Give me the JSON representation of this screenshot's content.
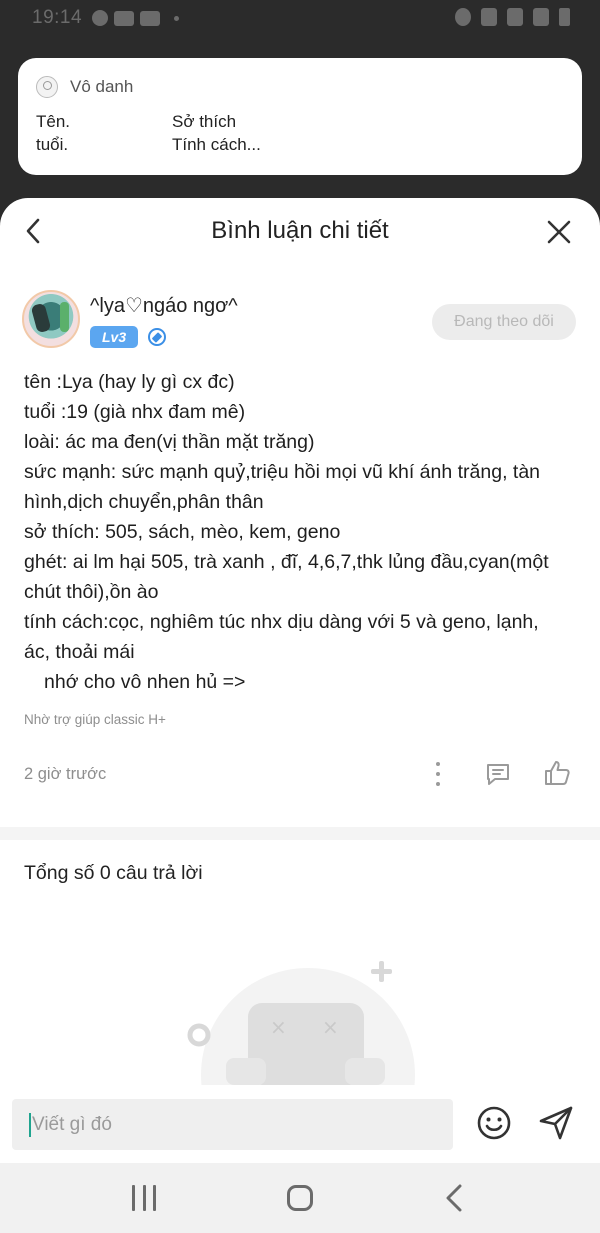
{
  "status_bar": {
    "time": "19:14"
  },
  "notification": {
    "sender": "Vô danh",
    "rows": [
      [
        "Tên.",
        "Sở thích"
      ],
      [
        "tuổi.",
        "Tính cách..."
      ]
    ]
  },
  "sheet": {
    "title": "Bình luận chi tiết"
  },
  "post": {
    "author": "^lya♡ngáo ngơ^",
    "level": "Lv3",
    "follow_label": "Đang theo dõi",
    "lines": [
      "tên :Lya (hay ly gì cx đc)",
      "tuổi :19 (già nhx đam mê)",
      "loài: ác ma đen(vị thần mặt trăng)",
      "sức mạnh: sức mạnh quỷ,triệu hồi mọi vũ khí ánh trăng, tàn",
      "hình,dịch chuyển,phân thân",
      "sở thích: 505, sách, mèo, kem, geno",
      "ghét: ai lm hại 505, trà xanh , đĩ, 4,6,7,thk lủng đầu,cyan(một",
      "chút thôi),ồn ào",
      "tính cách:cọc, nghiêm túc nhx dịu dàng với 5 và geno, lạnh,",
      "ác, thoải mái",
      "nhớ cho vô nhen hủ =>"
    ],
    "source": "Nhờ trợ giúp classic H+",
    "time_ago": "2 giờ trước"
  },
  "answers": {
    "count_label": "Tổng số 0 câu trả lời"
  },
  "input": {
    "placeholder": "Viết gì đó"
  },
  "colors": {
    "level_badge": "#5ba6f0",
    "caret": "#1fa48f",
    "follow_bg": "#ececec"
  }
}
